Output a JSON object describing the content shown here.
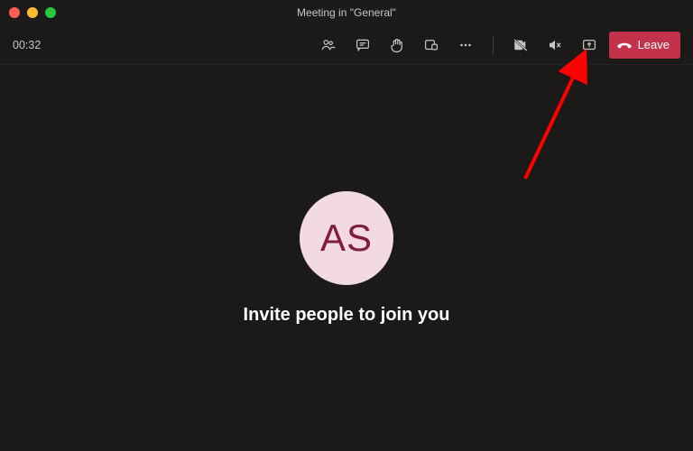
{
  "window": {
    "title": "Meeting in \"General\""
  },
  "toolbar": {
    "timer": "00:32",
    "leave_label": "Leave"
  },
  "participant": {
    "initials": "AS"
  },
  "stage": {
    "invite_text": "Invite people to join you"
  }
}
